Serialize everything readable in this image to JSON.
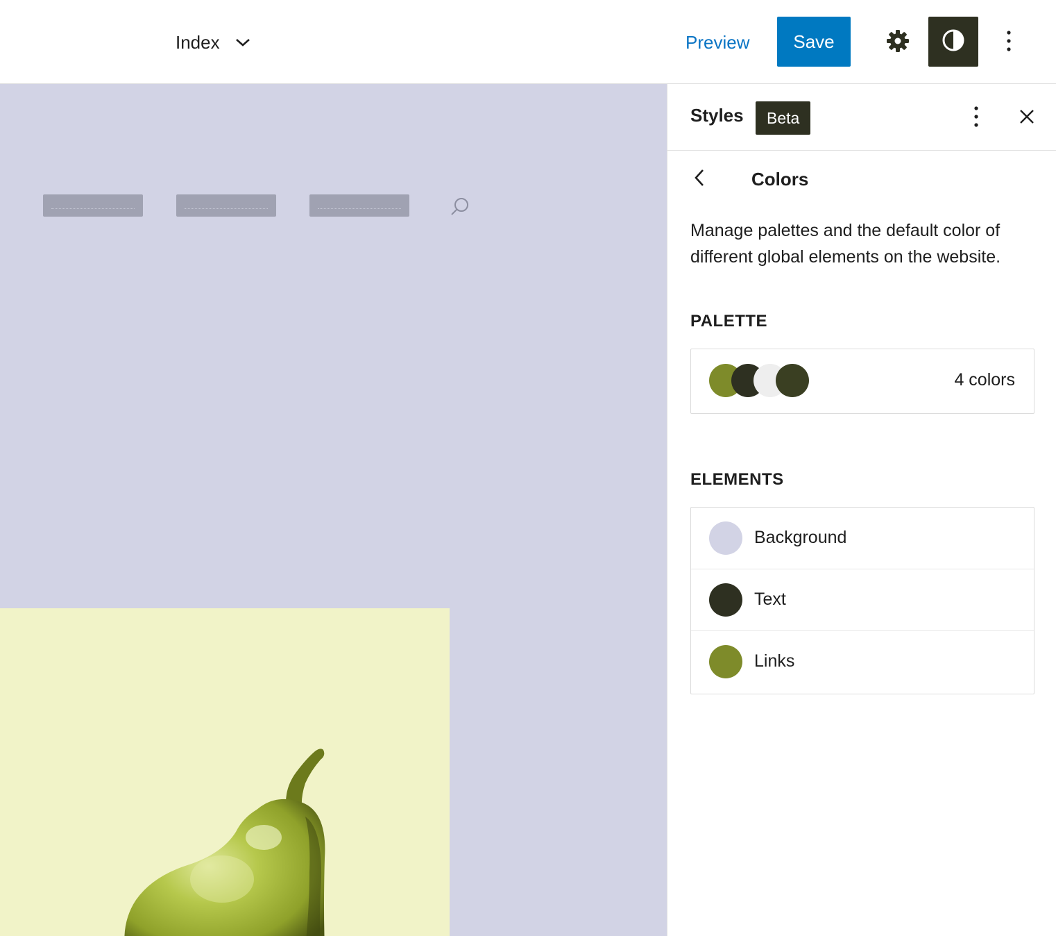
{
  "header": {
    "template_title": "Index",
    "preview_label": "Preview",
    "save_label": "Save",
    "icons": [
      "chevron-down-icon",
      "gear-icon",
      "half-circle-contrast-icon",
      "vertical-ellipsis-icon"
    ]
  },
  "sidebar": {
    "title": "Styles",
    "badge": "Beta",
    "panel": {
      "title": "Colors",
      "description": "Manage palettes and the default color of different global elements on the website.",
      "palette_heading": "PALETTE",
      "palette_count": "4 colors",
      "palette_colors": [
        "#7e8b2a",
        "#2e3021",
        "#eeeeee",
        "#3a3f22"
      ],
      "elements_heading": "ELEMENTS",
      "elements": [
        {
          "label": "Background",
          "color": "#d2d3e5"
        },
        {
          "label": "Text",
          "color": "#2e3021"
        },
        {
          "label": "Links",
          "color": "#7e8b2a"
        }
      ]
    }
  },
  "colors": {
    "accent": "#0079c1",
    "canvas_background": "#d2d3e5",
    "hero_background": "#f1f3c8",
    "dark": "#2e3021"
  }
}
